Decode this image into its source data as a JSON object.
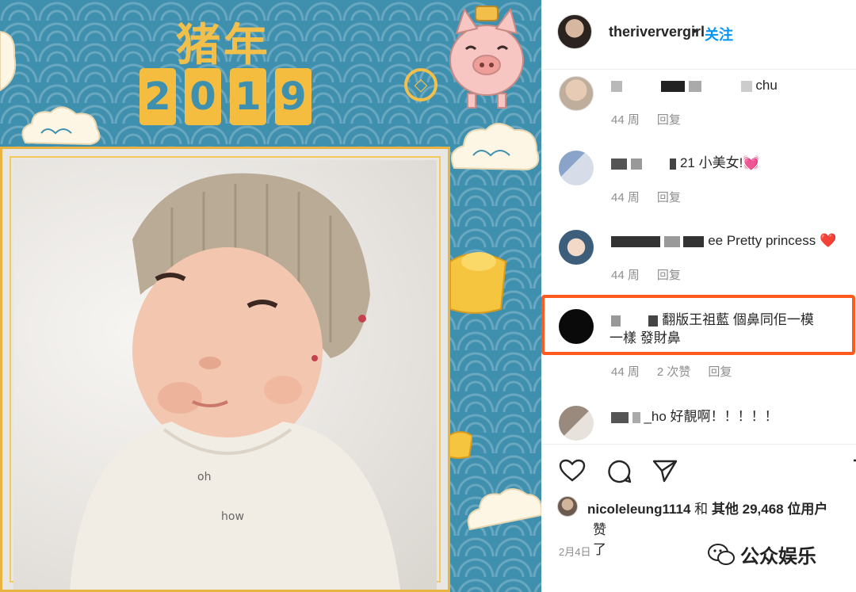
{
  "post_image": {
    "title": "猪年",
    "year_digits": [
      "2",
      "0",
      "1",
      "9"
    ]
  },
  "header": {
    "username": "theriververgirl",
    "separator": "•",
    "follow": "关注"
  },
  "comments": [
    {
      "text_visible": "chu",
      "time": "44 周",
      "reply": "回复",
      "likes": ""
    },
    {
      "text_visible": "21 小美女!💓",
      "time": "44 周",
      "reply": "回复",
      "likes": ""
    },
    {
      "text_visible": "ee Pretty princess ❤️",
      "time": "44 周",
      "reply": "回复",
      "likes": ""
    },
    {
      "text_line1": "翻版王祖藍 個鼻同佢一模",
      "text_line2": "一樣 發財鼻",
      "time": "44 周",
      "likes": "2 次赞",
      "reply": "回复"
    },
    {
      "text_visible": "_ho 好靚啊！！！！！",
      "time": "",
      "reply": "",
      "likes": ""
    }
  ],
  "likes_summary": {
    "liker": "nicoleleung1114",
    "and": "和",
    "others": "其他",
    "count": "29,468",
    "suffix": "位用户",
    "line2": "赞了"
  },
  "date": "2月4日",
  "watermark": "公众娱乐",
  "colors": {
    "follow_blue": "#0095f6",
    "highlight": "#ff5a1f",
    "muted": "#8e8e8e",
    "pattern_blue": "#3f8fae",
    "gold": "#f2c04a"
  }
}
